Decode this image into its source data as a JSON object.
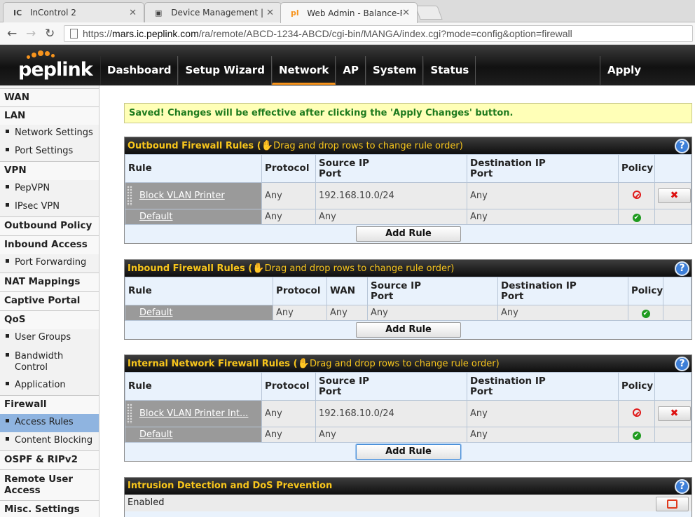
{
  "browser": {
    "tabs": [
      {
        "favicon": "IC",
        "title": "InControl 2"
      },
      {
        "favicon": "device-favicon",
        "title": "Device Management | Inco"
      },
      {
        "favicon": "pl",
        "title": "Web Admin - Balance-Rou"
      }
    ],
    "url_prefix": "https://",
    "url_host": "mars.ic.peplink.com",
    "url_path": "/ra/remote/ABCD-1234-ABCD/cgi-bin/MANGA/index.cgi?mode=config&option=firewall"
  },
  "app": {
    "logo": "peplink",
    "nav": [
      "Dashboard",
      "Setup Wizard",
      "Network",
      "AP",
      "System",
      "Status"
    ],
    "active_nav": "Network",
    "apply": "Apply Changes"
  },
  "sidebar": {
    "wan": "WAN",
    "lan": "LAN",
    "network_settings": "Network Settings",
    "port_settings": "Port Settings",
    "vpn": "VPN",
    "pepvpn": "PepVPN",
    "ipsec_vpn": "IPsec VPN",
    "outbound_policy": "Outbound Policy",
    "inbound_access": "Inbound Access",
    "port_forwarding": "Port Forwarding",
    "nat_mappings": "NAT Mappings",
    "captive_portal": "Captive Portal",
    "qos": "QoS",
    "user_groups": "User Groups",
    "bandwidth_control_1": "Bandwidth",
    "bandwidth_control_2": "Control",
    "application": "Application",
    "firewall": "Firewall",
    "access_rules": "Access Rules",
    "content_blocking": "Content Blocking",
    "ospf": "OSPF & RIPv2",
    "remote_user_access_1": "Remote User",
    "remote_user_access_2": "Access",
    "misc_settings": "Misc. Settings"
  },
  "notice": "Saved! Changes will be effective after clicking the 'Apply Changes' button.",
  "outbound": {
    "title": "Outbound Firewall Rules",
    "hint": "Drag and drop rows to change rule order)",
    "headers": {
      "rule": "Rule",
      "protocol": "Protocol",
      "source1": "Source IP",
      "source2": "Port",
      "dest1": "Destination IP",
      "dest2": "Port",
      "policy": "Policy"
    },
    "rows": [
      {
        "name": "Block VLAN Printer",
        "protocol": "Any",
        "source": "192.168.10.0/24",
        "dest": "Any",
        "policy": "deny"
      },
      {
        "name": "Default",
        "protocol": "Any",
        "source": "Any",
        "dest": "Any",
        "policy": "allow"
      }
    ],
    "add": "Add Rule"
  },
  "inbound": {
    "title": "Inbound Firewall Rules",
    "hint": "Drag and drop rows to change rule order)",
    "headers": {
      "rule": "Rule",
      "protocol": "Protocol",
      "wan": "WAN",
      "source1": "Source IP",
      "source2": "Port",
      "dest1": "Destination IP",
      "dest2": "Port",
      "policy": "Policy"
    },
    "rows": [
      {
        "name": "Default",
        "protocol": "Any",
        "wan": "Any",
        "source": "Any",
        "dest": "Any",
        "policy": "allow"
      }
    ],
    "add": "Add Rule"
  },
  "internal": {
    "title": "Internal Network Firewall Rules",
    "hint": "Drag and drop rows to change rule order)",
    "headers": {
      "rule": "Rule",
      "protocol": "Protocol",
      "source1": "Source IP",
      "source2": "Port",
      "dest1": "Destination IP",
      "dest2": "Port",
      "policy": "Policy"
    },
    "rows": [
      {
        "name": "Block VLAN Printer Int...",
        "protocol": "Any",
        "source": "192.168.10.0/24",
        "dest": "Any",
        "policy": "deny"
      },
      {
        "name": "Default",
        "protocol": "Any",
        "source": "Any",
        "dest": "Any",
        "policy": "allow"
      }
    ],
    "add": "Add Rule"
  },
  "ids": {
    "title": "Intrusion Detection and DoS Prevention",
    "status": "Enabled"
  },
  "colors": {
    "accent": "#f7941d",
    "panel_title": "#f7c51c",
    "notice_text": "#1e7a1e",
    "sidebar_active": "#8fb4e0"
  }
}
